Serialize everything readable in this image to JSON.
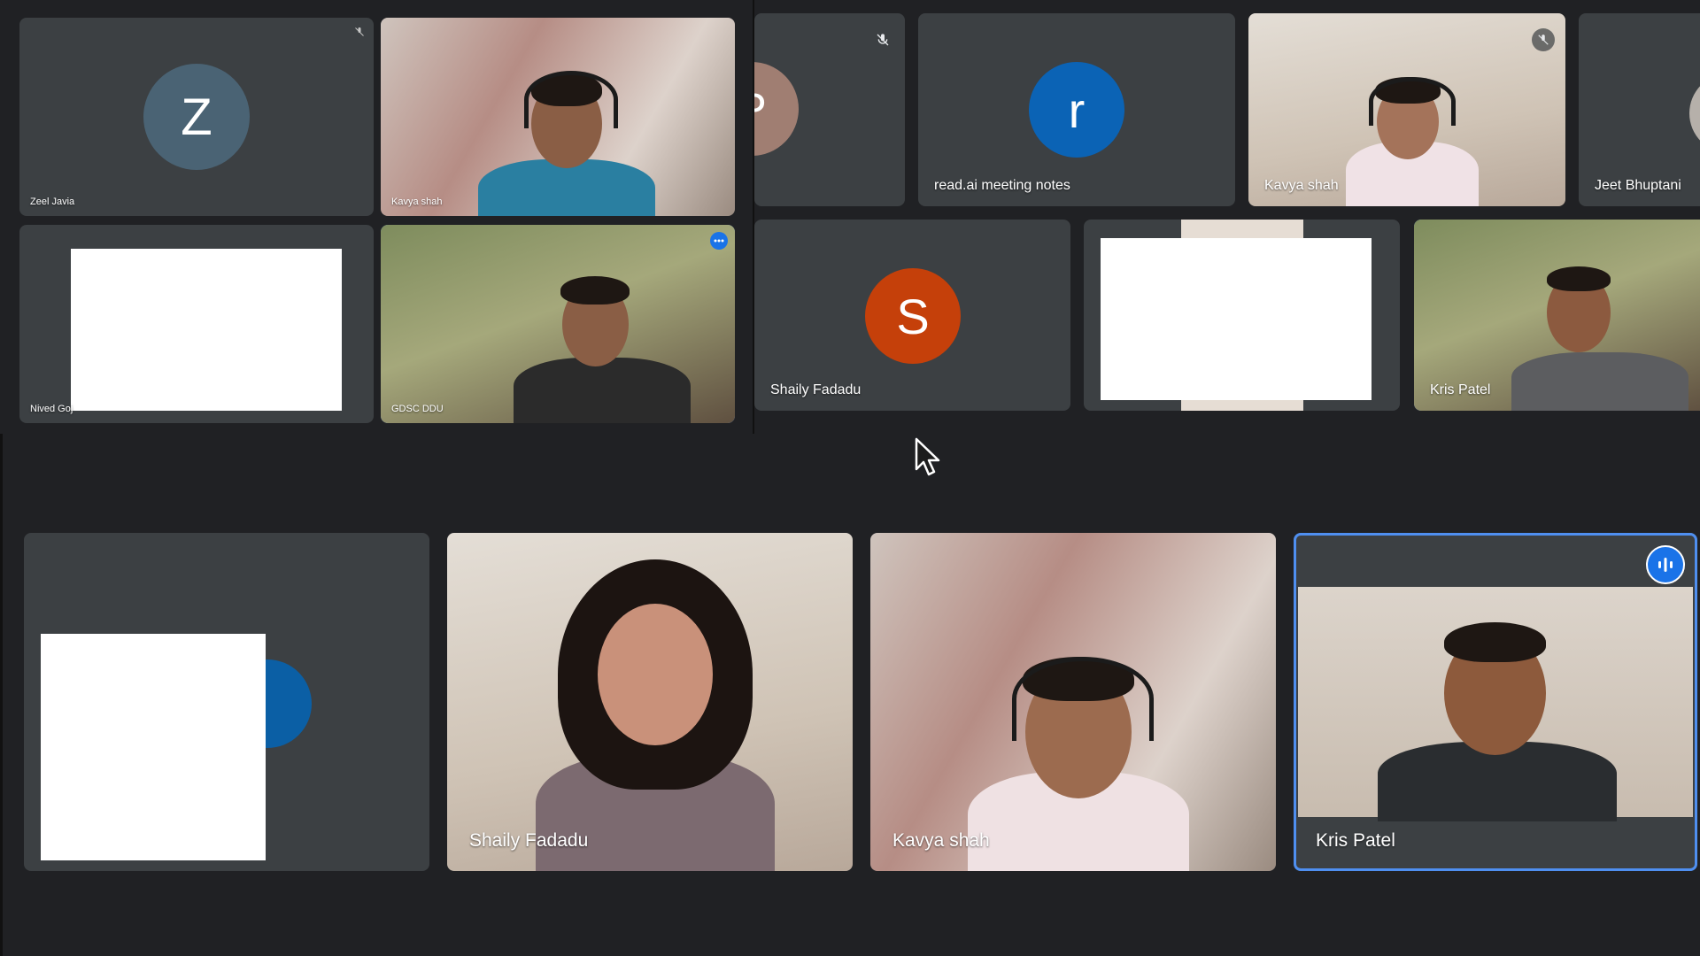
{
  "tiles": {
    "zeel": {
      "name": "Zeel Javia",
      "avatar_letter": "Z",
      "avatar_color": "#4a6374",
      "muted": true
    },
    "kavya_top_small": {
      "name": "Kavya shah"
    },
    "nived": {
      "name": "Nived Goj"
    },
    "gdsc": {
      "name": "GDSC DDU",
      "badge": "more-icon"
    },
    "partial_p": {
      "avatar_letter": "P",
      "avatar_color": "#a07e72",
      "muted": true
    },
    "readai": {
      "name": "read.ai meeting notes",
      "avatar_letter": "r",
      "avatar_color": "#0b63b5"
    },
    "kavya_top": {
      "name": "Kavya shah",
      "muted": true
    },
    "jeet": {
      "name": "Jeet Bhuptani"
    },
    "shaily_top": {
      "name": "Shaily Fadadu",
      "avatar_letter": "S",
      "avatar_color": "#c5400a"
    },
    "white_tile": {},
    "kris_top": {
      "name": "Kris Patel"
    },
    "bottom_first": {},
    "shaily_bottom": {
      "name": "Shaily Fadadu"
    },
    "kavya_bottom": {
      "name": "Kavya shah"
    },
    "kris_bottom": {
      "name": "Kris Patel",
      "badge": "speaking-icon"
    }
  },
  "colors": {
    "background": "#202124",
    "tile": "#3c4043",
    "active_border": "#4f8ff0",
    "speaking_badge": "#1a73e8"
  }
}
